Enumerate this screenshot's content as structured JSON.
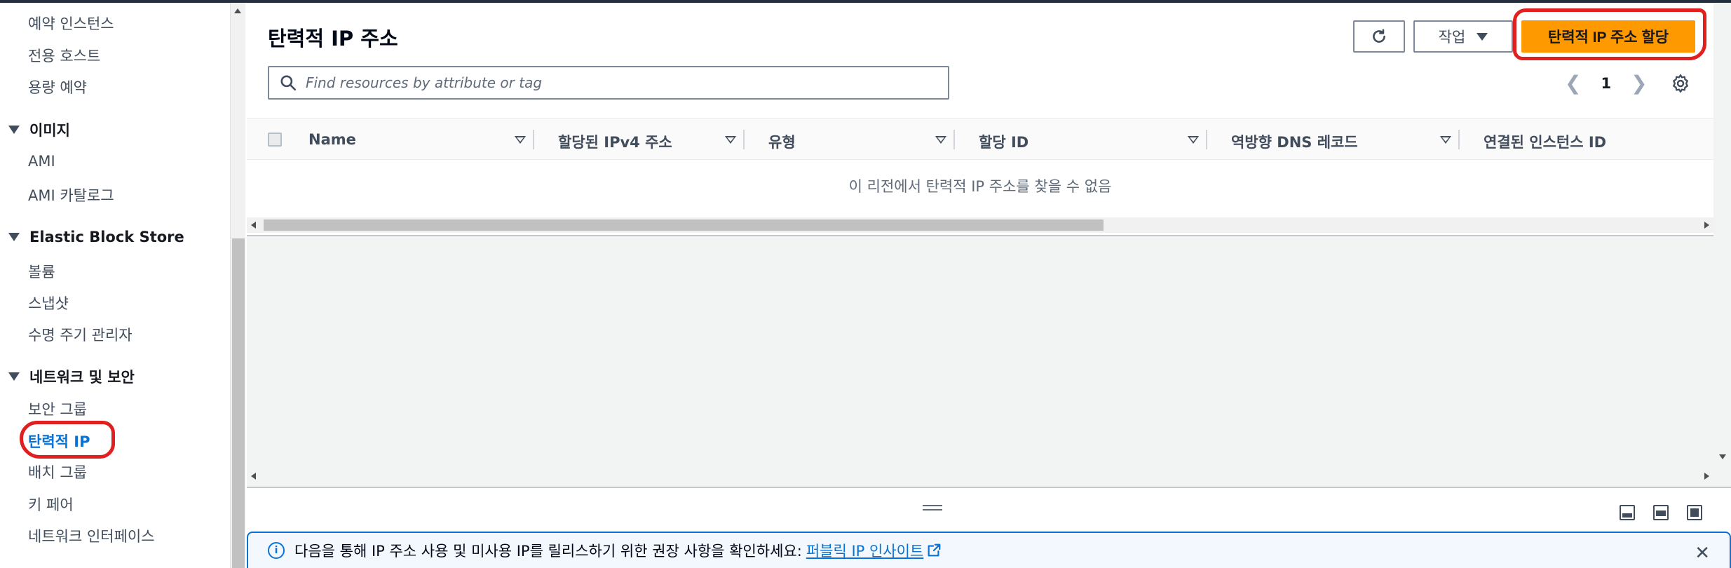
{
  "sidebar": {
    "items_top": [
      "예약 인스턴스",
      "전용 호스트",
      "용량 예약"
    ],
    "section_images": "이미지",
    "images_items": [
      "AMI",
      "AMI 카탈로그"
    ],
    "section_ebs": "Elastic Block Store",
    "ebs_items": [
      "볼륨",
      "스냅샷",
      "수명 주기 관리자"
    ],
    "section_network": "네트워크 및 보안",
    "network_items": [
      "보안 그룹",
      "탄력적 IP",
      "배치 그룹",
      "키 페어",
      "네트워크 인터페이스"
    ],
    "active_item": "탄력적 IP"
  },
  "header": {
    "title": "탄력적 IP 주소",
    "actions_label": "작업",
    "allocate_label": "탄력적 IP 주소 할당"
  },
  "search": {
    "placeholder": "Find resources by attribute or tag",
    "value": ""
  },
  "pagination": {
    "current_page": "1"
  },
  "table": {
    "columns": [
      "Name",
      "할당된 IPv4 주소",
      "유형",
      "할당 ID",
      "역방향 DNS 레코드",
      "연결된 인스턴스 ID"
    ],
    "empty_message": "이 리전에서 탄력적 IP 주소를 찾을 수 없음"
  },
  "flash": {
    "message": "다음을 통해 IP 주소 사용 및 미사용 IP를 릴리스하기 위한 권장 사항을 확인하세요:",
    "link_text": "퍼블릭 IP 인사이트"
  },
  "colors": {
    "primary_button": "#ff9900",
    "link": "#0972d3",
    "annotation": "#e02020"
  }
}
